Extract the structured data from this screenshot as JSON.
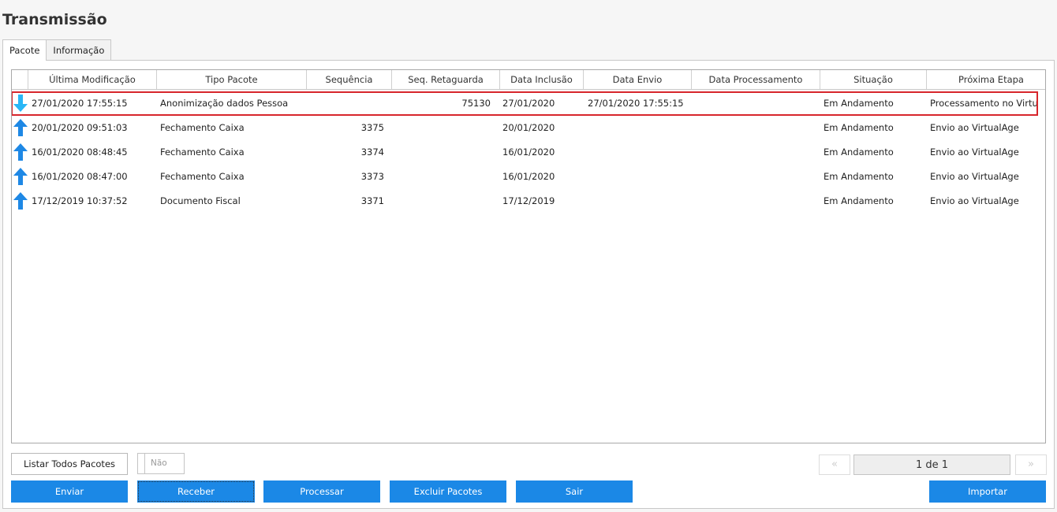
{
  "page": {
    "title": "Transmissão"
  },
  "tabs": [
    {
      "label": "Pacote",
      "active": true
    },
    {
      "label": "Informação",
      "active": false
    }
  ],
  "grid": {
    "columns": [
      "Última Modificação",
      "Tipo Pacote",
      "Sequência",
      "Seq. Retaguarda",
      "Data Inclusão",
      "Data Envio",
      "Data Processamento",
      "Situação",
      "Próxima Etapa"
    ],
    "rows": [
      {
        "icon": "arrow-down-icon",
        "icon_color": "#29b6f6",
        "ultima": "27/01/2020 17:55:15",
        "tipo": "Anonimização dados Pessoa",
        "seq": "",
        "seqret": "75130",
        "inclusao": "27/01/2020",
        "envio": "27/01/2020 17:55:15",
        "processamento": "",
        "situacao": "Em Andamento",
        "proxima": "Processamento no VirtualAge",
        "selected": true
      },
      {
        "icon": "arrow-up-icon",
        "icon_color": "#1e88e5",
        "ultima": "20/01/2020 09:51:03",
        "tipo": "Fechamento Caixa",
        "seq": "3375",
        "seqret": "",
        "inclusao": "20/01/2020",
        "envio": "",
        "processamento": "",
        "situacao": "Em Andamento",
        "proxima": "Envio ao VirtualAge",
        "selected": false
      },
      {
        "icon": "arrow-up-icon",
        "icon_color": "#1e88e5",
        "ultima": "16/01/2020 08:48:45",
        "tipo": "Fechamento Caixa",
        "seq": "3374",
        "seqret": "",
        "inclusao": "16/01/2020",
        "envio": "",
        "processamento": "",
        "situacao": "Em Andamento",
        "proxima": "Envio ao VirtualAge",
        "selected": false
      },
      {
        "icon": "arrow-up-icon",
        "icon_color": "#1e88e5",
        "ultima": "16/01/2020 08:47:00",
        "tipo": "Fechamento Caixa",
        "seq": "3373",
        "seqret": "",
        "inclusao": "16/01/2020",
        "envio": "",
        "processamento": "",
        "situacao": "Em Andamento",
        "proxima": "Envio ao VirtualAge",
        "selected": false
      },
      {
        "icon": "arrow-up-icon",
        "icon_color": "#1e88e5",
        "ultima": "17/12/2019 10:37:52",
        "tipo": "Documento Fiscal",
        "seq": "3371",
        "seqret": "",
        "inclusao": "17/12/2019",
        "envio": "",
        "processamento": "",
        "situacao": "Em Andamento",
        "proxima": "Envio ao VirtualAge",
        "selected": false
      }
    ]
  },
  "controls": {
    "listar_label": "Listar Todos Pacotes",
    "toggle_label": "Não",
    "pager_prev": "«",
    "pager_next": "»",
    "pager_text": "1 de 1"
  },
  "buttons": {
    "enviar": "Enviar",
    "receber": "Receber",
    "processar": "Processar",
    "excluir": "Excluir Pacotes",
    "sair": "Sair",
    "importar": "Importar"
  },
  "colors": {
    "primary_button": "#1b88e6",
    "selection_border": "#d7262c"
  }
}
